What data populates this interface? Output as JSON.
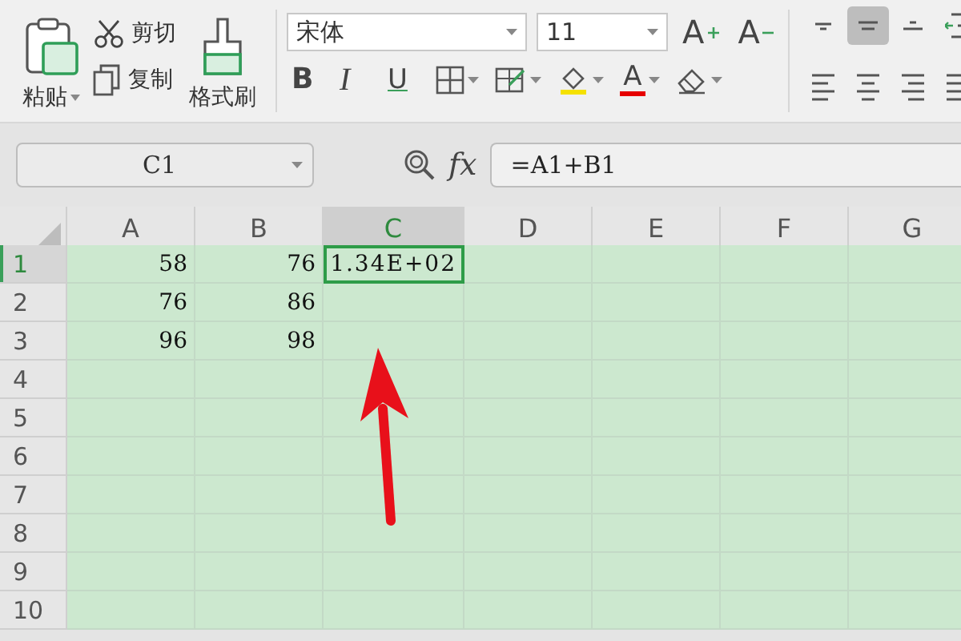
{
  "ribbon": {
    "clipboard": {
      "paste": "粘贴",
      "cut": "剪切",
      "copy": "复制",
      "format_painter": "格式刷"
    },
    "font": {
      "name": "宋体",
      "size": "11",
      "grow": "A",
      "shrink": "A"
    },
    "format_buttons": [
      {
        "kind": "bold",
        "label": "B"
      },
      {
        "kind": "italic",
        "label": "I"
      },
      {
        "kind": "underline",
        "label": "U"
      },
      {
        "kind": "borders"
      },
      {
        "kind": "cell-style"
      },
      {
        "kind": "fill-color",
        "color": "#f5e100"
      },
      {
        "kind": "font-color",
        "label": "A",
        "color": "#e60000"
      },
      {
        "kind": "clear"
      }
    ],
    "align_buttons": [
      {
        "kind": "top",
        "selected": false
      },
      {
        "kind": "middle",
        "selected": true
      },
      {
        "kind": "bottom",
        "selected": false
      },
      {
        "kind": "indent",
        "selected": false
      },
      {
        "kind": "left",
        "selected": false
      },
      {
        "kind": "center",
        "selected": false
      },
      {
        "kind": "right",
        "selected": false
      },
      {
        "kind": "justify",
        "selected": false
      }
    ]
  },
  "formula_bar": {
    "name_box": "C1",
    "fx": "fx",
    "formula": "=A1+B1"
  },
  "sheet": {
    "columns": [
      {
        "label": "A",
        "selected": false
      },
      {
        "label": "B",
        "selected": false
      },
      {
        "label": "C",
        "selected": true
      },
      {
        "label": "D",
        "selected": false
      },
      {
        "label": "E",
        "selected": false
      },
      {
        "label": "F",
        "selected": false
      },
      {
        "label": "G",
        "selected": false
      }
    ],
    "rows": [
      {
        "number": "1",
        "selected": true,
        "cells": [
          {
            "text": "58",
            "selected": false
          },
          {
            "text": "76",
            "selected": false
          },
          {
            "text": "1.34E+02",
            "selected": true
          }
        ]
      },
      {
        "number": "2",
        "selected": false,
        "cells": [
          {
            "text": "76",
            "selected": false
          },
          {
            "text": "86",
            "selected": false
          }
        ]
      },
      {
        "number": "3",
        "selected": false,
        "cells": [
          {
            "text": "96",
            "selected": false
          },
          {
            "text": "98",
            "selected": false
          }
        ]
      },
      {
        "number": "4",
        "selected": false
      },
      {
        "number": "5",
        "selected": false
      },
      {
        "number": "6",
        "selected": false
      },
      {
        "number": "7",
        "selected": false
      },
      {
        "number": "8",
        "selected": false
      },
      {
        "number": "9",
        "selected": false
      },
      {
        "number": "10",
        "selected": false
      }
    ]
  },
  "annotation": {
    "kind": "arrow",
    "color": "#e8101a"
  }
}
